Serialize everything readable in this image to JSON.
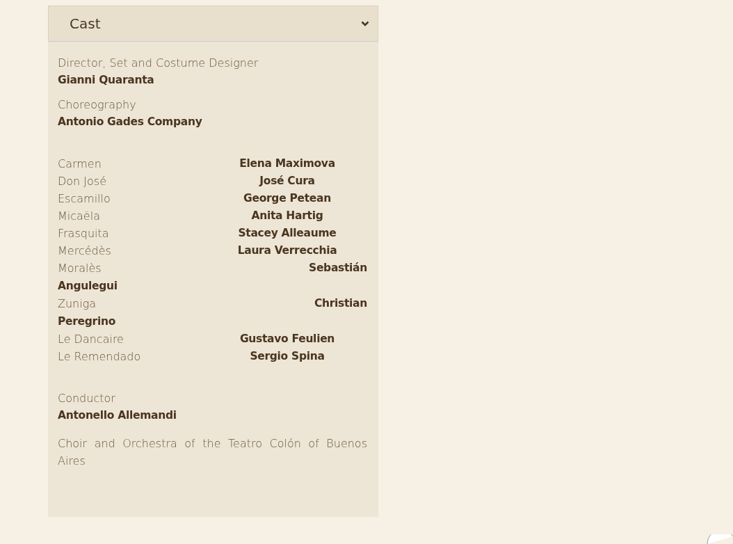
{
  "panel": {
    "title": "Cast",
    "expanded": true,
    "credits_top": [
      {
        "role": "Director, Set and Costume Designer",
        "name": "Gianni Quaranta"
      },
      {
        "role": "Choreography",
        "name": "Antonio Gades Company"
      }
    ],
    "cast": [
      {
        "kind": "pair",
        "role": "Carmen",
        "actor": "Elena Maximova"
      },
      {
        "kind": "pair",
        "role": "Don José",
        "actor": "José Cura"
      },
      {
        "kind": "pair",
        "role": "Escamillo",
        "actor": "George Petean"
      },
      {
        "kind": "pair",
        "role": "Micaëla",
        "actor": "Anita Hartig"
      },
      {
        "kind": "pair",
        "role": "Frasquita",
        "actor": "Stacey Alleaume"
      },
      {
        "kind": "pair",
        "role": "Mercédès",
        "actor": "Laura Verrecchia"
      },
      {
        "kind": "split",
        "role": "Moralès",
        "actor_lines": [
          "Sebastián",
          "Angulegui"
        ]
      },
      {
        "kind": "split",
        "role": "Zuniga",
        "actor_lines": [
          "Christian",
          "Peregrino"
        ]
      },
      {
        "kind": "pair",
        "role": "Le Dancaire",
        "actor": "Gustavo Feulien"
      },
      {
        "kind": "pair",
        "role": "Le Remendado",
        "actor": "Sergio Spina"
      }
    ],
    "credits_bottom": [
      {
        "role": "Conductor",
        "name": "Antonello Allemandi"
      }
    ],
    "note": "Choir and Orchestra of the Teatro Colón of Buenos Aires"
  }
}
